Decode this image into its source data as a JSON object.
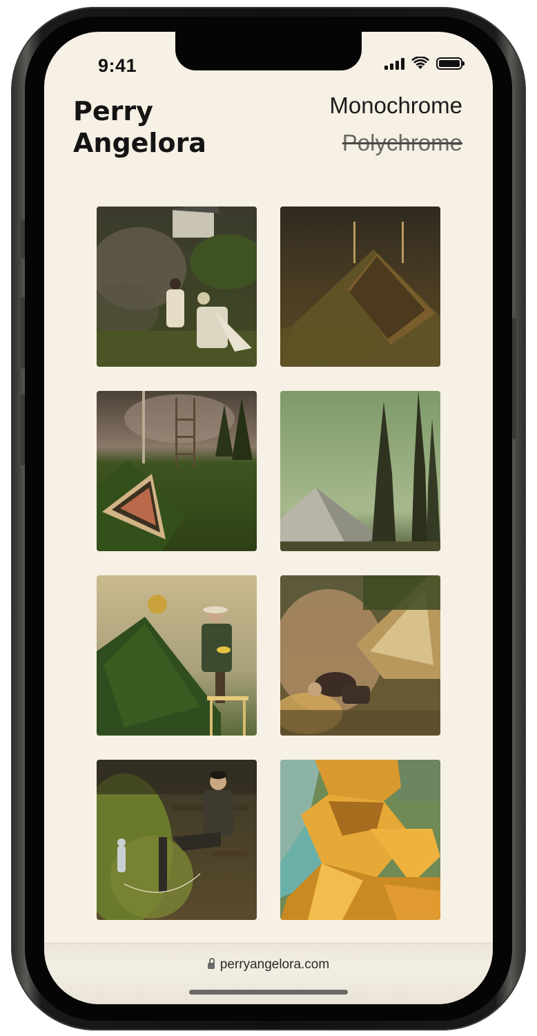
{
  "status_bar": {
    "time": "9:41"
  },
  "header": {
    "artist_name": "Perry Angelora"
  },
  "nav": {
    "monochrome": "Monochrome",
    "polychrome": "Polychrome"
  },
  "browser": {
    "url": "perryangelora.com"
  },
  "gallery": {
    "paintings": [
      {
        "subject": "figures beside a seated woman, smoke and a house"
      },
      {
        "subject": "grass-covered pyramid at dusk"
      },
      {
        "subject": "triangular hedge with a ladder and cypress trees"
      },
      {
        "subject": "pyramid and tall cypress trees under a green sky"
      },
      {
        "subject": "man painting a face on a hedge from a stool"
      },
      {
        "subject": "man crouching beside a glowing fire and a pyramid"
      },
      {
        "subject": "man seated on a bench knitting a figure"
      },
      {
        "subject": "faceted golden cubist figure"
      }
    ]
  }
}
